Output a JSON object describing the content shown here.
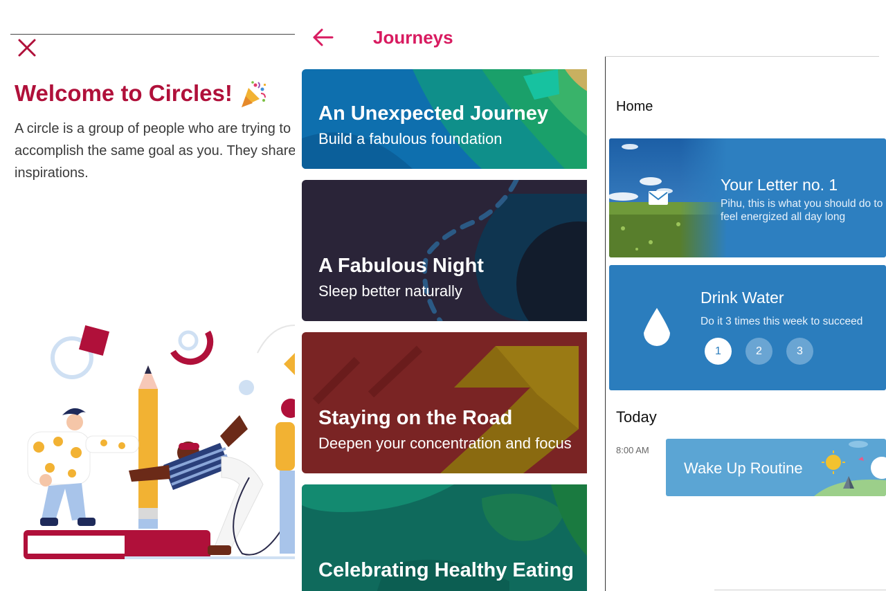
{
  "circles": {
    "title": "Welcome to Circles!",
    "title_emoji": "party-popper-icon",
    "description": "A circle is a group of people who are trying to accomplish the same goal as you. They share daily inspirations.",
    "accent_color": "#b0103a"
  },
  "journeys": {
    "title": "Journeys",
    "accent_color": "#d81b60",
    "cards": [
      {
        "title": "An Unexpected Journey",
        "subtitle": "Build a fabulous foundation"
      },
      {
        "title": "A Fabulous Night",
        "subtitle": "Sleep better naturally"
      },
      {
        "title": "Staying on the Road",
        "subtitle": "Deepen your concentration and focus"
      },
      {
        "title": "Celebrating Healthy Eating",
        "subtitle": ""
      }
    ]
  },
  "home": {
    "title": "Home",
    "letter": {
      "title": "Your Letter no. 1",
      "text_line1": "Pihu, this is what you should do to",
      "text_line2": "feel energized all day long"
    },
    "water": {
      "title": "Drink Water",
      "text": "Do it 3 times this week to succeed",
      "steps": [
        "1",
        "2",
        "3"
      ],
      "active_step": "1"
    },
    "today_label": "Today",
    "routine": {
      "time": "8:00 AM",
      "title": "Wake Up Routine"
    },
    "card_color": "#2d7fc0"
  }
}
